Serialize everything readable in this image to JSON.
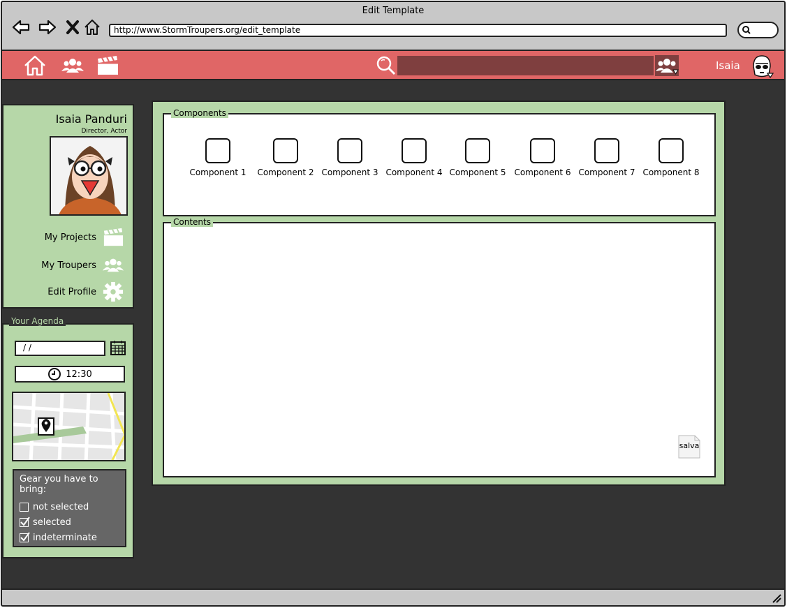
{
  "window": {
    "title": "Edit Template",
    "url": "http://www.StormTroupers.org/edit_template"
  },
  "appbar": {
    "search_placeholder": "",
    "username": "Isaia"
  },
  "profile": {
    "name": "Isaia Panduri",
    "role": "Director,  Actor",
    "links": {
      "projects": "My Projects",
      "troupers": "My Troupers",
      "edit": "Edit Profile"
    }
  },
  "agenda": {
    "legend": "Your Agenda",
    "date_value": "/ /",
    "time_value": "12:30",
    "gear_title": "Gear you have to bring:",
    "gear_items": [
      {
        "label": "not selected",
        "checked": false
      },
      {
        "label": "selected",
        "checked": true
      },
      {
        "label": "indeterminate",
        "checked": true
      }
    ]
  },
  "editor": {
    "components_legend": "Components",
    "components": [
      "Component 1",
      "Component 2",
      "Component 3",
      "Component 4",
      "Component 5",
      "Component 6",
      "Component 7",
      "Component 8"
    ],
    "contents_legend": "Contents",
    "save_label": "salva"
  },
  "colors": {
    "header": "#e06666",
    "panel": "#b6d7a8",
    "background": "#333333",
    "search": "#7f3f3f"
  }
}
